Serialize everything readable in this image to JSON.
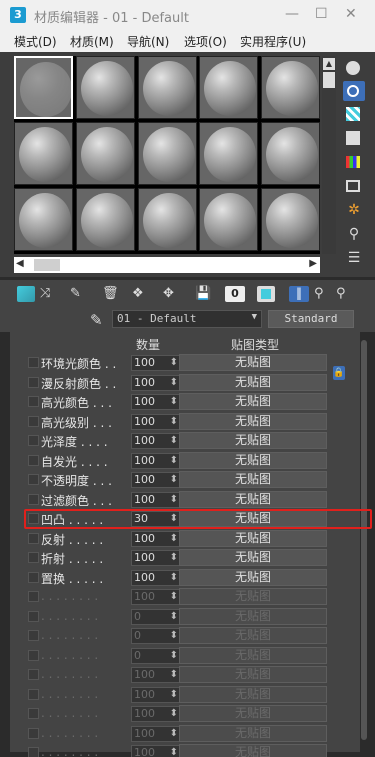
{
  "window": {
    "title": "材质编辑器 - 01 - Default",
    "logo": "3"
  },
  "menu": [
    "模式(D)",
    "材质(M)",
    "导航(N)",
    "选项(O)",
    "实用程序(U)"
  ],
  "material": {
    "name": "01 - Default",
    "type_button": "Standard"
  },
  "maps_header": {
    "amount": "数量",
    "map_type": "贴图类型"
  },
  "maps": [
    {
      "label": "环境光颜色 . .",
      "amount": "100",
      "map": "无贴图"
    },
    {
      "label": "漫反射颜色 . .",
      "amount": "100",
      "map": "无贴图"
    },
    {
      "label": "高光颜色 . . .",
      "amount": "100",
      "map": "无贴图"
    },
    {
      "label": "高光级别 . . .",
      "amount": "100",
      "map": "无贴图"
    },
    {
      "label": "光泽度 . . . .",
      "amount": "100",
      "map": "无贴图"
    },
    {
      "label": "自发光 . . . .",
      "amount": "100",
      "map": "无贴图"
    },
    {
      "label": "不透明度 . . .",
      "amount": "100",
      "map": "无贴图"
    },
    {
      "label": "过滤颜色 . . .",
      "amount": "100",
      "map": "无贴图"
    },
    {
      "label": "凹凸 . . . . .",
      "amount": "30",
      "map": "无贴图"
    },
    {
      "label": "反射 . . . . .",
      "amount": "100",
      "map": "无贴图"
    },
    {
      "label": "折射 . . . . .",
      "amount": "100",
      "map": "无贴图"
    },
    {
      "label": "置换 . . . . .",
      "amount": "100",
      "map": "无贴图"
    },
    {
      "label": ". . . . . . . .",
      "amount": "100",
      "map": "无贴图"
    },
    {
      "label": ". . . . . . . .",
      "amount": "0",
      "map": "无贴图"
    },
    {
      "label": ". . . . . . . .",
      "amount": "0",
      "map": "无贴图"
    },
    {
      "label": ". . . . . . . .",
      "amount": "0",
      "map": "无贴图"
    },
    {
      "label": ". . . . . . . .",
      "amount": "100",
      "map": "无贴图"
    },
    {
      "label": ". . . . . . . .",
      "amount": "100",
      "map": "无贴图"
    },
    {
      "label": ". . . . . . . .",
      "amount": "100",
      "map": "无贴图"
    },
    {
      "label": ". . . . . . . .",
      "amount": "100",
      "map": "无贴图"
    },
    {
      "label": ". . . . . . . .",
      "amount": "100",
      "map": "无贴图"
    }
  ],
  "colors": {
    "highlight": "#e0201c",
    "logo": "#1b9bd1"
  }
}
